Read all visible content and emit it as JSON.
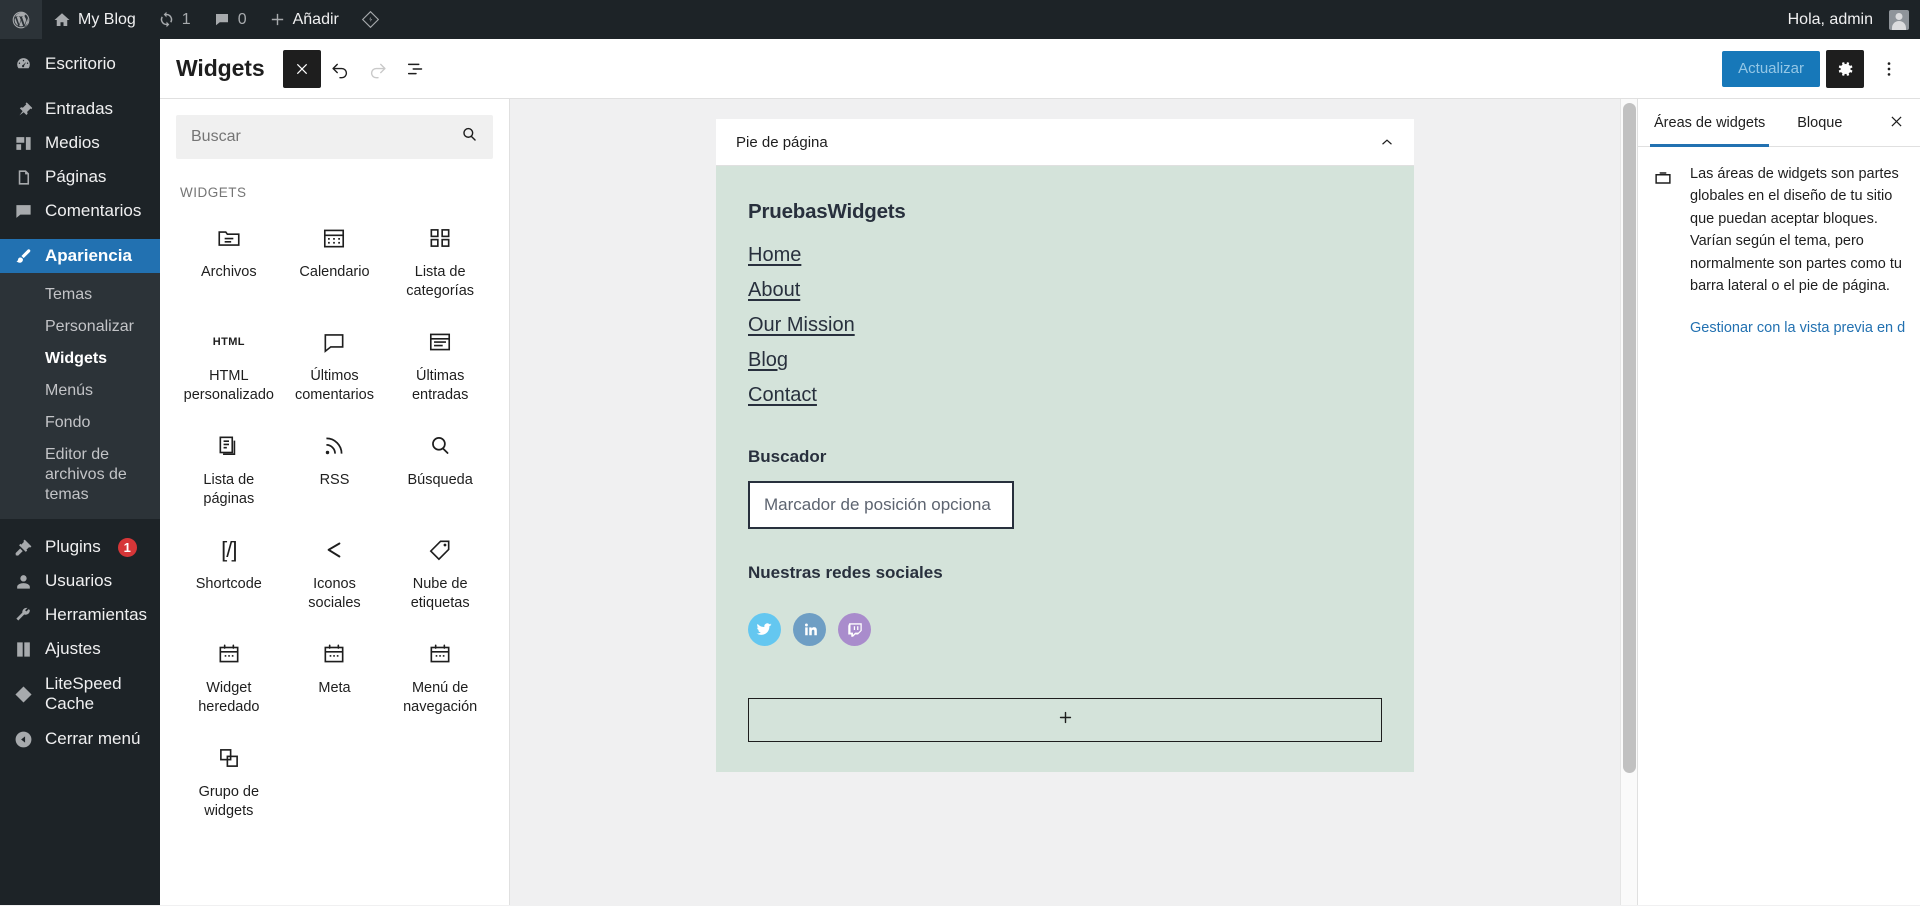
{
  "adminbar": {
    "logo_icon": "wordpress-icon",
    "site_name": "My Blog",
    "site_icon": "home-icon",
    "updates_icon": "updates-icon",
    "updates_count": "1",
    "comments_icon": "comment-icon",
    "comments_count": "0",
    "new_icon": "plus-icon",
    "new_label": "Añadir",
    "litespeed_icon": "litespeed-icon",
    "greeting": "Hola, admin",
    "avatar": "avatar-icon"
  },
  "adminmenu": {
    "items": [
      {
        "label": "Escritorio",
        "icon": "dashboard-icon"
      },
      {
        "label": "Entradas",
        "icon": "pin-icon"
      },
      {
        "label": "Medios",
        "icon": "media-icon"
      },
      {
        "label": "Páginas",
        "icon": "pages-icon"
      },
      {
        "label": "Comentarios",
        "icon": "comment-icon"
      },
      {
        "label": "Apariencia",
        "icon": "brush-icon",
        "current": true
      },
      {
        "label": "Plugins",
        "icon": "plugin-icon",
        "badge": "1"
      },
      {
        "label": "Usuarios",
        "icon": "user-icon"
      },
      {
        "label": "Herramientas",
        "icon": "wrench-icon"
      },
      {
        "label": "Ajustes",
        "icon": "settings-icon"
      },
      {
        "label": "LiteSpeed Cache",
        "icon": "litespeed-icon"
      },
      {
        "label": "Cerrar menú",
        "icon": "collapse-icon"
      }
    ],
    "appearance_submenu": [
      {
        "label": "Temas"
      },
      {
        "label": "Personalizar"
      },
      {
        "label": "Widgets",
        "current": true
      },
      {
        "label": "Menús"
      },
      {
        "label": "Fondo"
      },
      {
        "label": "Editor de archivos de temas"
      }
    ]
  },
  "editor_header": {
    "title": "Widgets",
    "close_icon": "close-icon",
    "undo_icon": "undo-icon",
    "redo_icon": "redo-icon",
    "list_view_icon": "list-view-icon",
    "update_label": "Actualizar",
    "settings_icon": "gear-icon",
    "options_icon": "three-dots-icon"
  },
  "inserter": {
    "search_placeholder": "Buscar",
    "search_value": "",
    "search_icon": "search-icon",
    "category_label": "WIDGETS",
    "widgets": [
      {
        "label": "Archivos",
        "icon": "archive-icon"
      },
      {
        "label": "Calendario",
        "icon": "calendar-icon"
      },
      {
        "label": "Lista de categorías",
        "icon": "category-list-icon"
      },
      {
        "label": "HTML personalizado",
        "icon": "html-icon"
      },
      {
        "label": "Últimos comentarios",
        "icon": "comment-icon"
      },
      {
        "label": "Últimas entradas",
        "icon": "latest-posts-icon"
      },
      {
        "label": "Lista de páginas",
        "icon": "page-list-icon"
      },
      {
        "label": "RSS",
        "icon": "rss-icon"
      },
      {
        "label": "Búsqueda",
        "icon": "search-icon"
      },
      {
        "label": "Shortcode",
        "icon": "shortcode-icon"
      },
      {
        "label": "Iconos sociales",
        "icon": "share-icon"
      },
      {
        "label": "Nube de etiquetas",
        "icon": "tag-icon"
      },
      {
        "label": "Widget heredado",
        "icon": "legacy-widget-icon"
      },
      {
        "label": "Meta",
        "icon": "legacy-widget-icon"
      },
      {
        "label": "Menú de navegación",
        "icon": "legacy-widget-icon"
      },
      {
        "label": "Grupo de widgets",
        "icon": "group-icon"
      }
    ]
  },
  "canvas": {
    "widget_area_title": "Pie de página",
    "collapse_icon": "chevron-up-icon",
    "background_color": "#d4e3da",
    "site_title": "PruebasWidgets",
    "nav_links": [
      "Home",
      "About",
      "Our Mission",
      "Blog",
      "Contact"
    ],
    "search_heading": "Buscador",
    "search_placeholder": "Marcador de posición opciona",
    "search_value": "",
    "social_heading": "Nuestras redes sociales",
    "social_icons": [
      {
        "name": "twitter-icon",
        "color": "#64c7f0"
      },
      {
        "name": "linkedin-icon",
        "color": "#6e9ec4"
      },
      {
        "name": "twitch-icon",
        "color": "#a98ccc"
      }
    ],
    "add_block_icon": "plus-icon"
  },
  "sidebar": {
    "tabs": [
      {
        "label": "Áreas de widgets",
        "active": true
      },
      {
        "label": "Bloque",
        "active": false
      }
    ],
    "close_icon": "close-icon",
    "panel_icon": "widget-area-icon",
    "description": "Las áreas de widgets son partes globales en el diseño de tu sitio que puedan aceptar bloques. Varían según el tema, pero normalmente son partes como tu barra lateral o el pie de página.",
    "link_label": "Gestionar con la vista previa en directo"
  }
}
